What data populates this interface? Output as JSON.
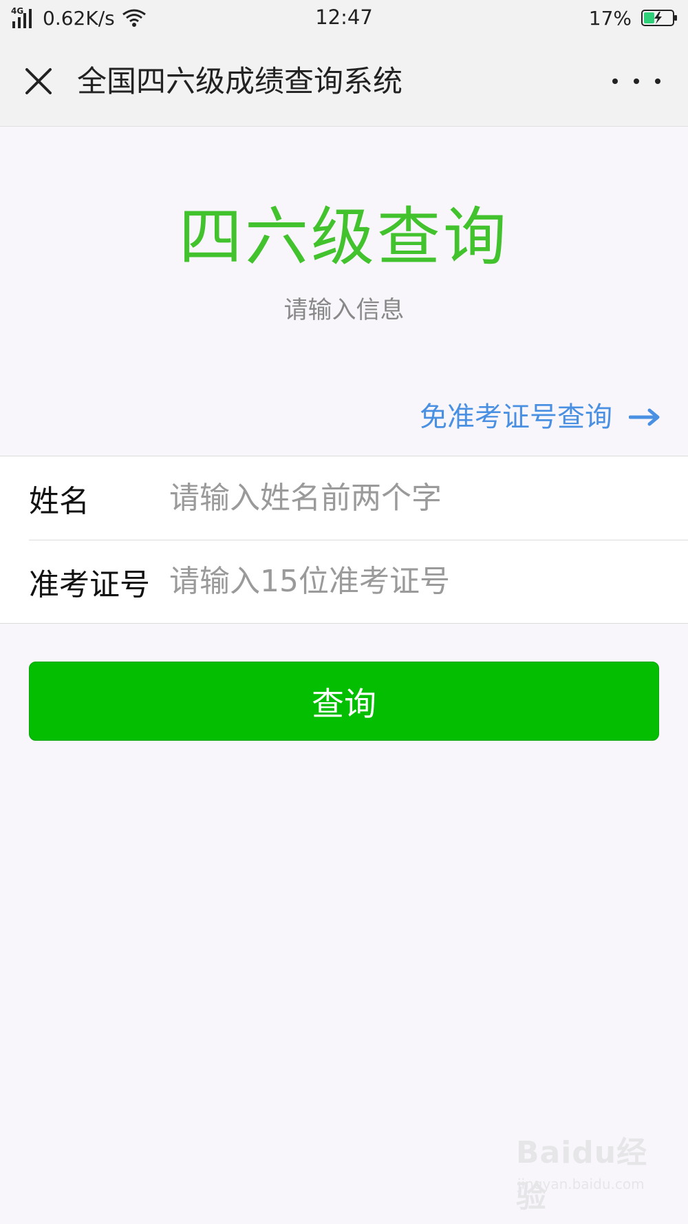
{
  "status_bar": {
    "network_type": "4G",
    "speed": "0.62K/s",
    "time": "12:47",
    "battery_percent": "17%",
    "battery_level": 0.17,
    "battery_color": "#2fd07a"
  },
  "header": {
    "title": "全国四六级成绩查询系统",
    "close_icon": "close-icon",
    "more_icon": "more-icon"
  },
  "hero": {
    "title": "四六级查询",
    "subtitle": "请输入信息",
    "title_color": "#42c22d"
  },
  "alt_link": {
    "label": "免准考证号查询",
    "icon": "arrow-right-icon",
    "color": "#4a90e2"
  },
  "form": {
    "name_label": "姓名",
    "name_placeholder": "请输入姓名前两个字",
    "name_value": "",
    "ticket_label": "准考证号",
    "ticket_placeholder": "请输入15位准考证号",
    "ticket_value": ""
  },
  "submit": {
    "label": "查询",
    "color": "#04be02"
  },
  "watermark": {
    "logo": "Baidu经验",
    "url": "jingyan.baidu.com"
  }
}
